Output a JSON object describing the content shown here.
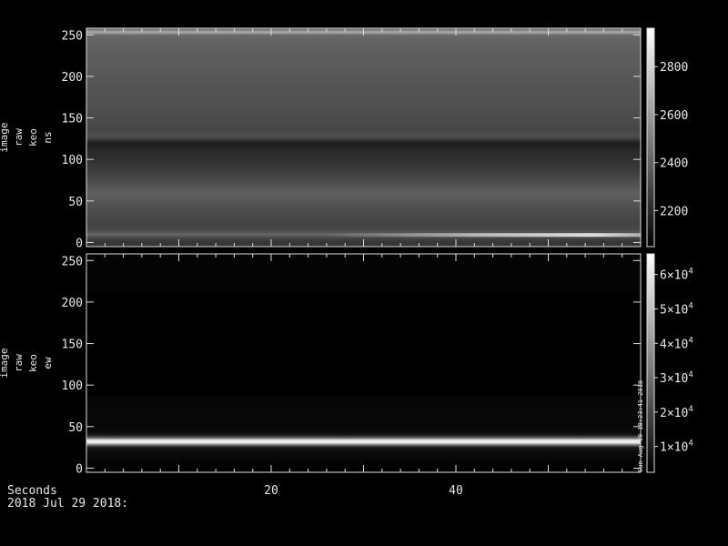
{
  "footer": {
    "x_axis_title": "Seconds",
    "date_label": "2018 Jul 29 2018:"
  },
  "watermark": "Sun Aug 19 18:23:41 2018",
  "chart_data": [
    {
      "type": "heatmap",
      "ylabel_lines": [
        "image",
        "raw",
        "keo",
        "ns"
      ],
      "xlim": [
        0,
        60
      ],
      "ylim": [
        -5,
        258
      ],
      "xticks": [
        20,
        40
      ],
      "yticks": [
        0,
        50,
        100,
        150,
        200,
        250
      ],
      "color_scale": "grayscale",
      "colorbar": {
        "range": [
          2050,
          2960
        ],
        "ticks": [
          2200,
          2400,
          2600,
          2800
        ],
        "tick_labels": [
          "2200",
          "2400",
          "2600",
          "2800"
        ]
      },
      "row_profile": [
        [
          -5,
          2230
        ],
        [
          3,
          2260
        ],
        [
          7,
          2330
        ],
        [
          10,
          2430
        ],
        [
          12,
          2350
        ],
        [
          17,
          2300
        ],
        [
          25,
          2290
        ],
        [
          40,
          2330
        ],
        [
          60,
          2390
        ],
        [
          80,
          2290
        ],
        [
          100,
          2220
        ],
        [
          110,
          2200
        ],
        [
          115,
          2170
        ],
        [
          120,
          2150
        ],
        [
          124,
          2260
        ],
        [
          128,
          2330
        ],
        [
          135,
          2300
        ],
        [
          160,
          2330
        ],
        [
          200,
          2360
        ],
        [
          240,
          2400
        ],
        [
          250,
          2420
        ],
        [
          253,
          2700
        ],
        [
          256,
          2500
        ],
        [
          258,
          2300
        ]
      ],
      "features": [
        {
          "label": "bright streak",
          "x": [
            26,
            60
          ],
          "y": 9,
          "value": 2850
        }
      ]
    },
    {
      "type": "heatmap",
      "ylabel_lines": [
        "image",
        "raw",
        "keo",
        "ew"
      ],
      "xlim": [
        0,
        60
      ],
      "ylim": [
        -5,
        258
      ],
      "xticks": [
        20,
        40
      ],
      "yticks": [
        0,
        50,
        100,
        150,
        200,
        250
      ],
      "color_scale": "grayscale",
      "colorbar": {
        "range": [
          2500,
          66000
        ],
        "ticks": [
          10000,
          20000,
          30000,
          40000,
          50000,
          60000
        ],
        "tick_labels": [
          "1×10",
          "2×10",
          "3×10",
          "4×10",
          "5×10",
          "6×10"
        ],
        "tick_exponent": "4"
      },
      "row_profile": [
        [
          -5,
          2800
        ],
        [
          2,
          3500
        ],
        [
          5,
          3000
        ],
        [
          10,
          4000
        ],
        [
          20,
          5500
        ],
        [
          25,
          9000
        ],
        [
          28,
          30000
        ],
        [
          30,
          60000
        ],
        [
          32,
          64000
        ],
        [
          34,
          60000
        ],
        [
          36,
          30000
        ],
        [
          40,
          8000
        ],
        [
          45,
          4600
        ],
        [
          60,
          4400
        ],
        [
          75,
          4200
        ],
        [
          85,
          4000
        ],
        [
          88,
          2600
        ],
        [
          120,
          2500
        ],
        [
          170,
          2500
        ],
        [
          212,
          2600
        ],
        [
          215,
          3600
        ],
        [
          258,
          3600
        ]
      ],
      "features": []
    }
  ]
}
